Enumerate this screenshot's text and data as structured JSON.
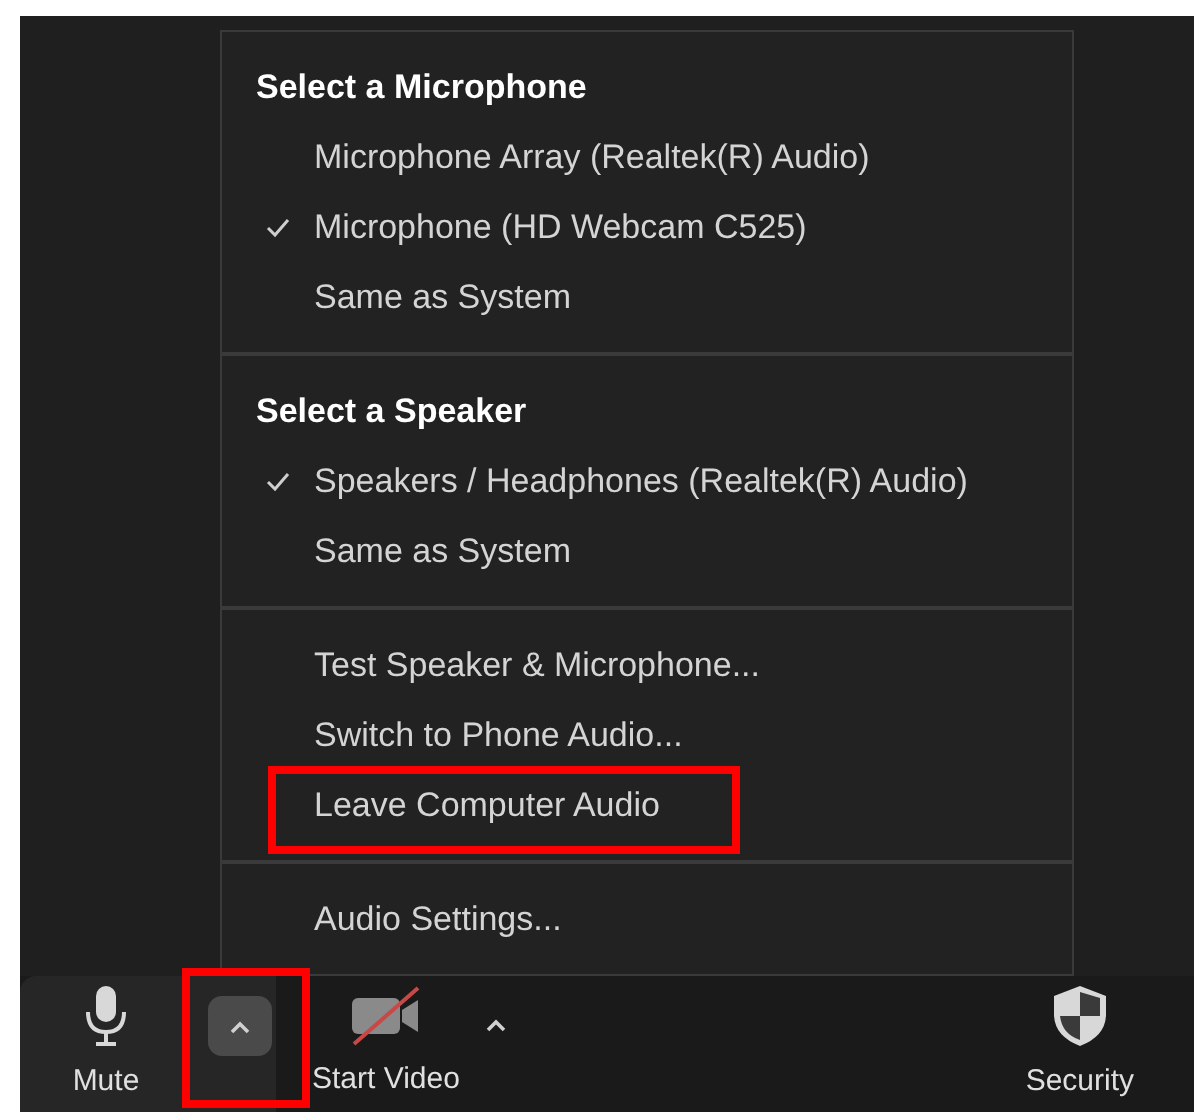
{
  "menu": {
    "sections": [
      {
        "title": "Select a Microphone",
        "items": [
          {
            "label": "Microphone Array (Realtek(R) Audio)",
            "checked": false,
            "highlighted": false
          },
          {
            "label": "Microphone (HD Webcam C525)",
            "checked": true,
            "highlighted": false
          },
          {
            "label": "Same as System",
            "checked": false,
            "highlighted": false
          }
        ]
      },
      {
        "title": "Select a Speaker",
        "items": [
          {
            "label": "Speakers / Headphones (Realtek(R) Audio)",
            "checked": true,
            "highlighted": false
          },
          {
            "label": "Same as System",
            "checked": false,
            "highlighted": false
          }
        ]
      },
      {
        "items": [
          {
            "label": "Test Speaker & Microphone...",
            "checked": false,
            "highlighted": false
          },
          {
            "label": "Switch to Phone Audio...",
            "checked": false,
            "highlighted": false
          },
          {
            "label": "Leave Computer Audio",
            "checked": false,
            "highlighted": true
          }
        ]
      },
      {
        "items": [
          {
            "label": "Audio Settings...",
            "checked": false,
            "highlighted": false
          }
        ]
      }
    ]
  },
  "toolbar": {
    "buttons": [
      {
        "kind": "audio",
        "label": "Mute",
        "menu_highlighted": true
      },
      {
        "kind": "video",
        "label": "Start Video"
      },
      {
        "kind": "security",
        "label": "Security"
      }
    ]
  }
}
